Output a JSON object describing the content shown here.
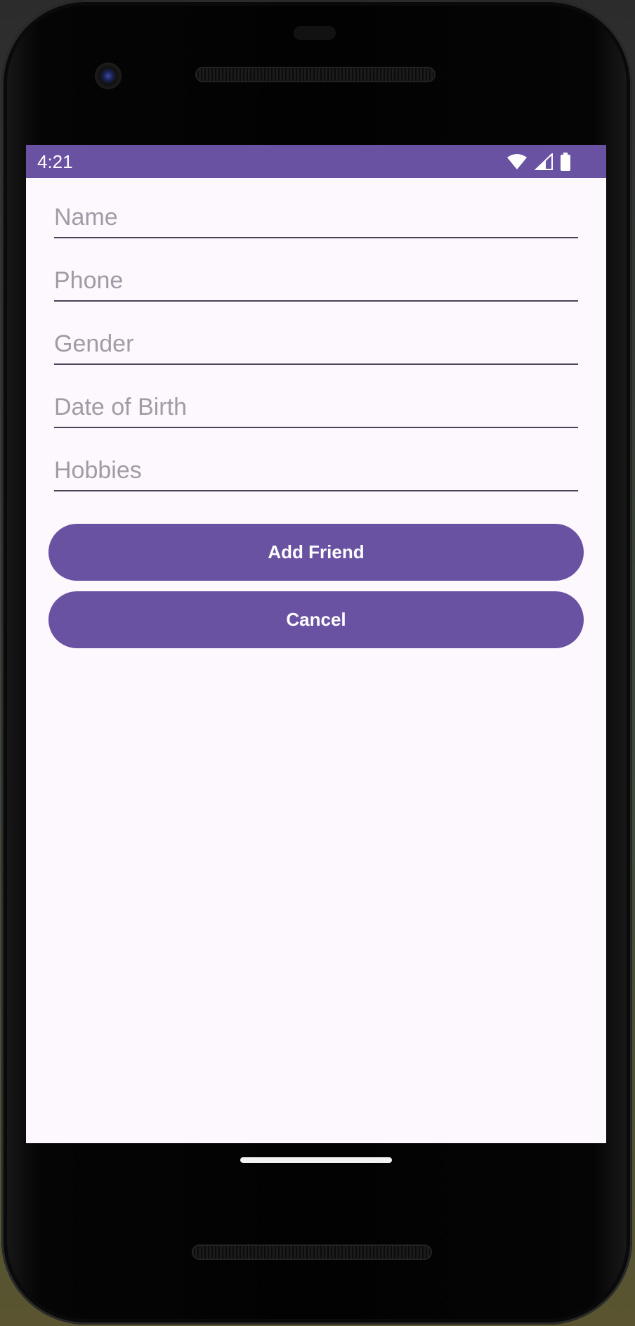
{
  "status_bar": {
    "time": "4:21",
    "icons": [
      "wifi-icon",
      "cell-signal-icon",
      "battery-icon"
    ]
  },
  "form": {
    "fields": [
      {
        "name": "name",
        "placeholder": "Name",
        "value": ""
      },
      {
        "name": "phone",
        "placeholder": "Phone",
        "value": ""
      },
      {
        "name": "gender",
        "placeholder": "Gender",
        "value": ""
      },
      {
        "name": "date-of-birth",
        "placeholder": "Date of Birth",
        "value": ""
      },
      {
        "name": "hobbies",
        "placeholder": "Hobbies",
        "value": ""
      }
    ],
    "add_label": "Add Friend",
    "cancel_label": "Cancel"
  },
  "colors": {
    "primary": "#6a52a3",
    "background": "#fdf7fe",
    "placeholder": "#a19ba6"
  }
}
